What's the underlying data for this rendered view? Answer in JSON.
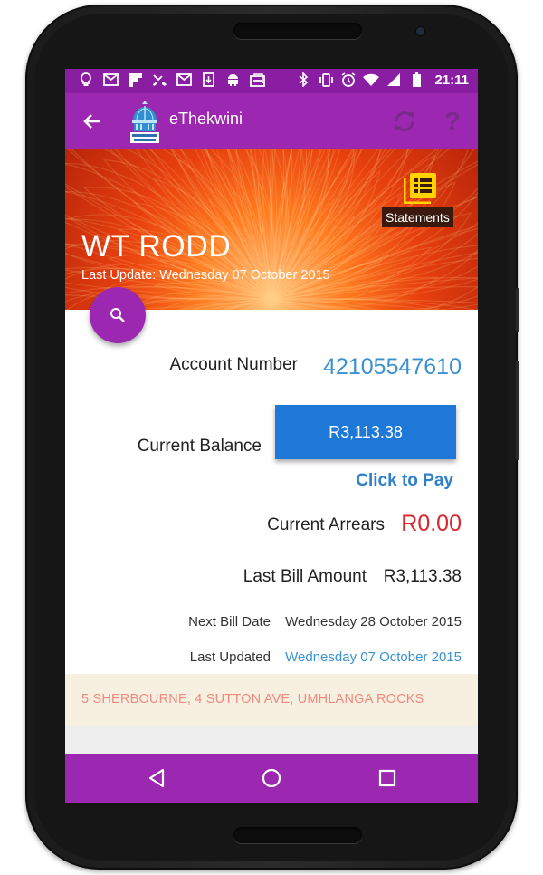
{
  "status_bar": {
    "time": "21:11",
    "left_icons": [
      "bulb-icon",
      "mail-icon",
      "flipboard-icon",
      "missed-call-icon",
      "mail-icon",
      "download-icon",
      "android-icon",
      "inbox-icon"
    ],
    "right_icons": [
      "bluetooth-icon",
      "vibrate-icon",
      "alarm-icon",
      "wifi-icon",
      "signal-icon",
      "battery-icon"
    ]
  },
  "app_bar": {
    "title": "eThekwini",
    "help_symbol": "?"
  },
  "hero": {
    "statements_label": "Statements",
    "account_holder": "WT RODD",
    "last_update": "Last Update: Wednesday 07 October 2015"
  },
  "account": {
    "number_label": "Account Number",
    "number": "42105547610",
    "balance_label": "Current Balance",
    "balance": "R3,113.38",
    "click_to_pay": "Click to Pay",
    "arrears_label": "Current Arrears",
    "arrears": "R0.00",
    "last_bill_label": "Last Bill Amount",
    "last_bill": "R3,113.38",
    "next_bill_label": "Next Bill Date",
    "next_bill": "Wednesday 28 October 2015",
    "last_updated_label": "Last Updated",
    "last_updated": "Wednesday 07 October 2015"
  },
  "address": "5 SHERBOURNE, 4 SUTTON AVE, UMHLANGA ROCKS",
  "colors": {
    "primary": "#9c27b0",
    "status_bar": "#8a1ea3",
    "pay_button": "#1e78d8",
    "link_blue": "#3a91d0",
    "arrears_red": "#d9262e",
    "address_text": "#f08a80",
    "address_bg": "#f7efe0"
  }
}
